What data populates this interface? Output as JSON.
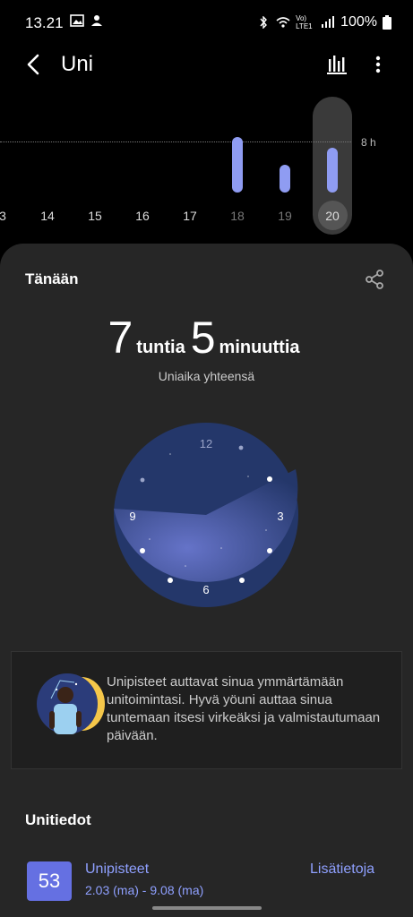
{
  "status_bar": {
    "time": "13.21",
    "battery": "100%",
    "network": "Vo) LTE1"
  },
  "app_bar": {
    "title": "Uni",
    "back_icon": "back-arrow-icon",
    "chart_icon": "bar-chart-icon",
    "more_icon": "more-vert-icon"
  },
  "week_chart": {
    "guide_label": "8 h",
    "days": [
      "3",
      "14",
      "15",
      "16",
      "17",
      "18",
      "19",
      "20"
    ],
    "selected_day": "20",
    "bar_color": "#8f9cf2"
  },
  "chart_data": {
    "type": "bar",
    "categories": [
      "18",
      "19",
      "20"
    ],
    "values": [
      8.7,
      4.3,
      7.08
    ],
    "ylabel": "",
    "reference_line": 8
  },
  "today_card": {
    "title": "Tänään",
    "hours": "7",
    "hours_unit": "tuntia",
    "minutes": "5",
    "minutes_unit": "minuuttia",
    "subtitle": "Uniaika yhteensä",
    "clock_labels": [
      "12",
      "3",
      "6",
      "9"
    ]
  },
  "tip": {
    "text": "Unipisteet auttavat sinua ymmärtämään unitoimintasi. Hyvä yöuni auttaa sinua tuntemaan itsesi virkeäksi ja valmistautumaan päivään."
  },
  "sleep_info": {
    "section_title": "Unitiedot",
    "score": "53",
    "score_label": "Unipisteet",
    "score_range": "2.03 (ma) - 9.08 (ma)",
    "more_link": "Lisätietoja",
    "accent": "#6570e2"
  }
}
